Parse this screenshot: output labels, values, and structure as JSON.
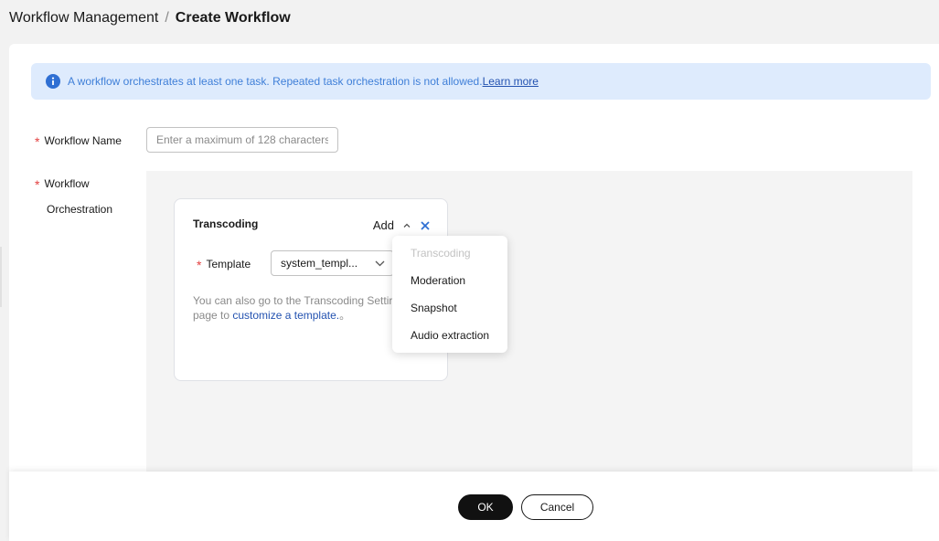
{
  "breadcrumb": {
    "parent": "Workflow Management",
    "separator": "/",
    "current": "Create Workflow"
  },
  "notice": {
    "text": "A workflow orchestrates at least one task. Repeated task orchestration is not allowed.",
    "link": "Learn more",
    "icon": "info-icon"
  },
  "form": {
    "required_mark": "*",
    "name_label": "Workflow Name",
    "name_placeholder": "Enter a maximum of 128 characters",
    "name_value": "",
    "orchestration_label_line1": "Workflow",
    "orchestration_label_line2": "Orchestration"
  },
  "task": {
    "title": "Transcoding",
    "add_label": "Add",
    "template_label": "Template",
    "template_value": "system_templ...",
    "hint_text": "You can also go to the Transcoding Settir",
    "hint_text2": "page to ",
    "hint_link": "customize a template.",
    "hint_suffix": "。"
  },
  "dropdown": {
    "items": [
      {
        "label": "Transcoding",
        "disabled": true
      },
      {
        "label": "Moderation",
        "disabled": false
      },
      {
        "label": "Snapshot",
        "disabled": false
      },
      {
        "label": "Audio extraction",
        "disabled": false
      }
    ]
  },
  "footer": {
    "ok_label": "OK",
    "cancel_label": "Cancel"
  },
  "colors": {
    "accent": "#2352b0",
    "info_bg": "#deebfd",
    "required": "#e34141",
    "primary_button": "#111111"
  }
}
